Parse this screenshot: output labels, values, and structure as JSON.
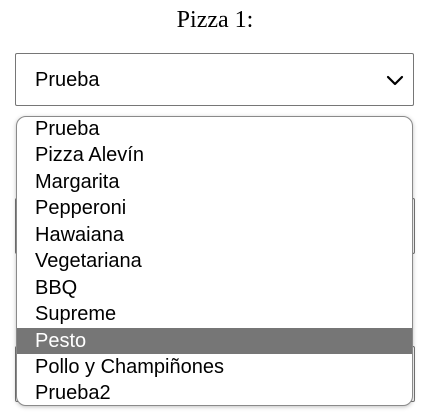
{
  "heading": "Pizza 1:",
  "select": {
    "value": "Prueba",
    "icon": "chevron-down-icon"
  },
  "listbox": {
    "options": [
      "Prueba",
      "Pizza Alevín",
      "Margarita",
      "Pepperoni",
      "Hawaiana",
      "Vegetariana",
      "BBQ",
      "Supreme",
      "Pesto",
      "Pollo y Champiñones",
      "Prueba2"
    ],
    "highlighted": "Pesto",
    "highlight_color": "#767676"
  }
}
